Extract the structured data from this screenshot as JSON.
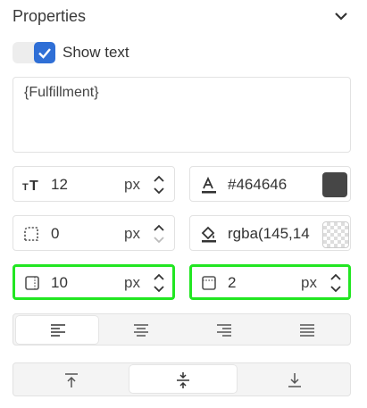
{
  "header": {
    "title": "Properties"
  },
  "show_text": {
    "label": "Show text",
    "checked": true
  },
  "text_value": "{Fulfillment}",
  "font_size": {
    "value": "12",
    "unit": "px",
    "icon": "font-size-icon"
  },
  "font_color": {
    "value": "#464646",
    "swatch": "#464646",
    "icon": "text-color-icon"
  },
  "corner_radius": {
    "value": "0",
    "unit": "px",
    "icon": "corner-radius-icon"
  },
  "fill_color": {
    "value": "rgba(145,14",
    "icon": "fill-bucket-icon"
  },
  "padding": {
    "value": "10",
    "unit": "px",
    "icon": "padding-icon"
  },
  "border_width": {
    "value": "2",
    "unit": "px",
    "icon": "border-icon"
  },
  "horizontal_align": {
    "options": [
      "left",
      "center",
      "right",
      "justify"
    ],
    "selected": "left"
  },
  "vertical_align": {
    "options": [
      "top",
      "middle",
      "bottom"
    ],
    "selected": "middle"
  },
  "colors": {
    "checkbox": "#2f6fd6",
    "highlight": "#22e622"
  }
}
